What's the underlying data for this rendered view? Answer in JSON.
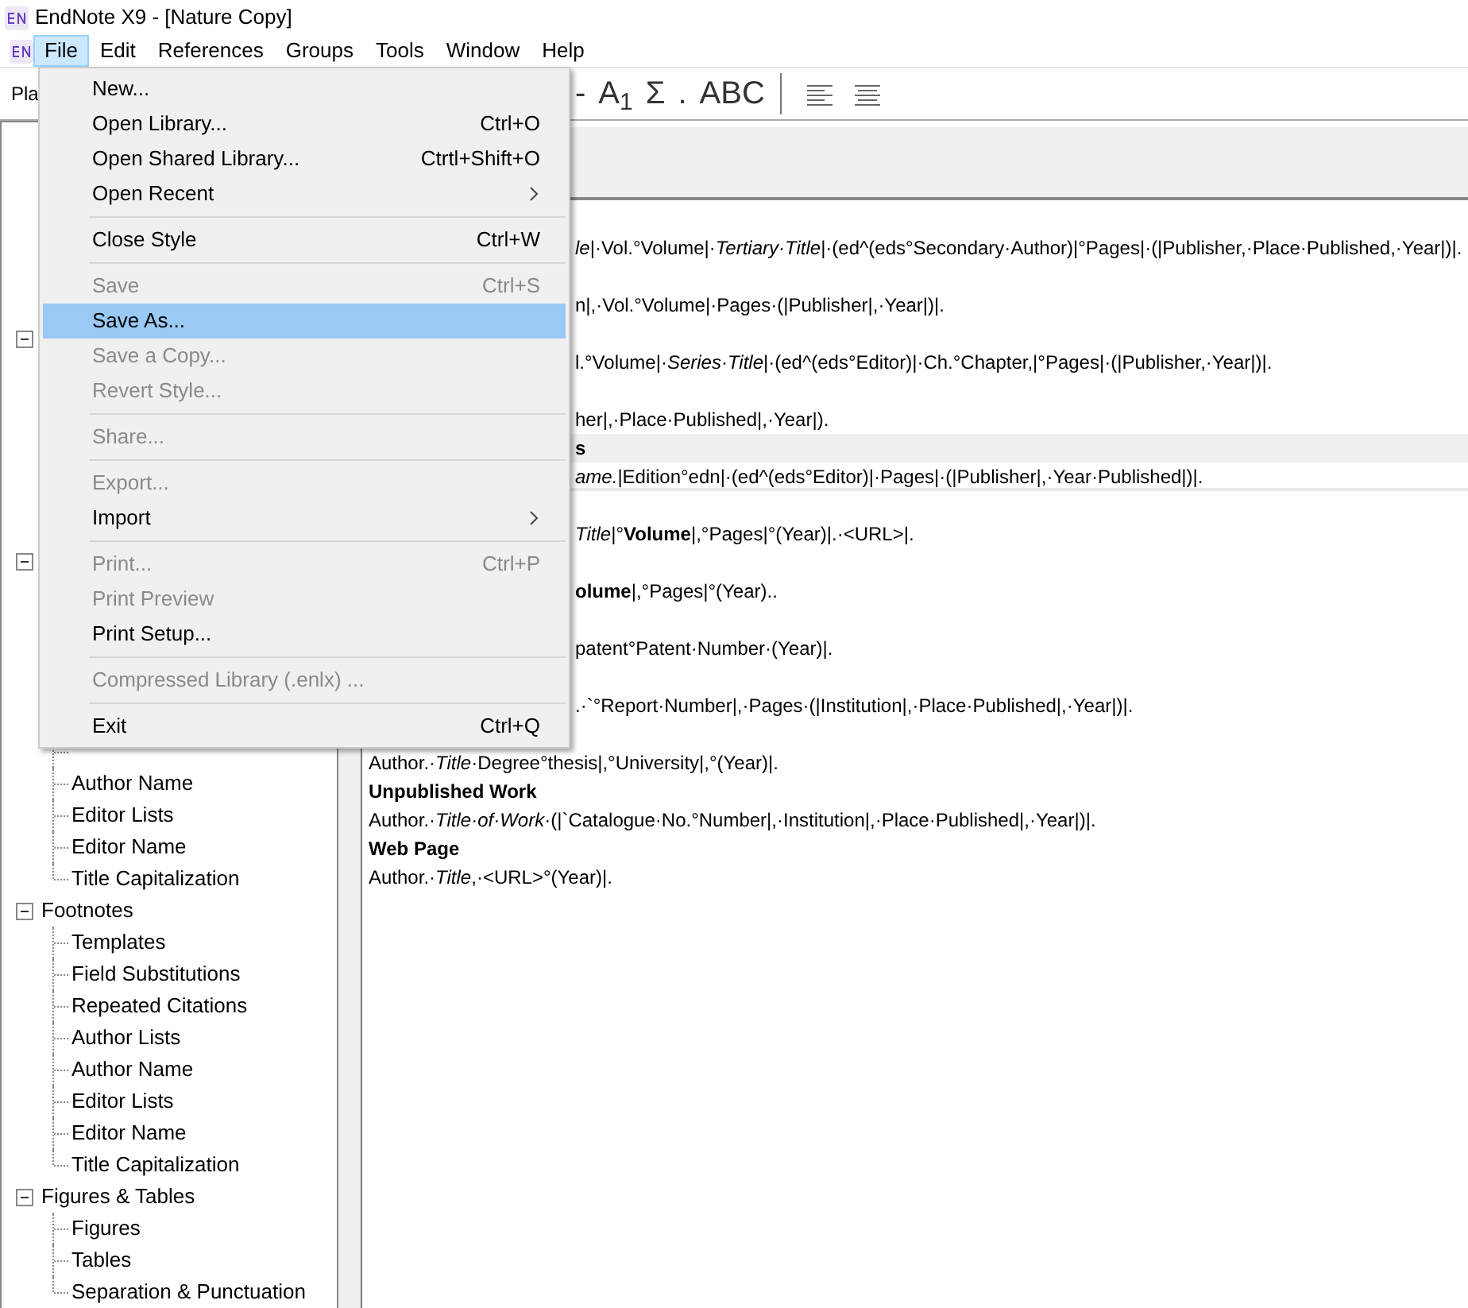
{
  "window": {
    "title": "EndNote X9 - [Nature Copy]"
  },
  "menubar": [
    {
      "label": "File",
      "selected": true
    },
    {
      "label": "Edit",
      "selected": false
    },
    {
      "label": "References",
      "selected": false
    },
    {
      "label": "Groups",
      "selected": false
    },
    {
      "label": "Tools",
      "selected": false
    },
    {
      "label": "Window",
      "selected": false
    },
    {
      "label": "Help",
      "selected": false
    }
  ],
  "toolbar": {
    "field_label": "Pla",
    "buttons": [
      {
        "kind": "text",
        "label": "-"
      },
      {
        "kind": "text",
        "label": "A$_{1}$"
      },
      {
        "kind": "text",
        "label": "Σ"
      },
      {
        "kind": "text",
        "label": "."
      },
      {
        "kind": "text",
        "label": "ABC"
      },
      {
        "kind": "separator"
      },
      {
        "kind": "align-left"
      },
      {
        "kind": "align-center"
      }
    ]
  },
  "tree": [
    {
      "expanded": true
    },
    {
      "expanded": true,
      "children": [
        {
          "label": "Author Name"
        },
        {
          "label": "Editor Lists"
        },
        {
          "label": "Editor Name"
        },
        {
          "label": "Title Capitalization"
        }
      ]
    },
    {
      "label": "Footnotes",
      "expanded": true,
      "children": [
        {
          "label": "Templates"
        },
        {
          "label": "Field Substitutions"
        },
        {
          "label": "Repeated Citations"
        },
        {
          "label": "Author Lists"
        },
        {
          "label": "Author Name"
        },
        {
          "label": "Editor Lists"
        },
        {
          "label": "Editor Name"
        },
        {
          "label": "Title Capitalization"
        }
      ]
    },
    {
      "label": "Figures & Tables",
      "expanded": true,
      "children": [
        {
          "label": "Figures"
        },
        {
          "label": "Tables"
        },
        {
          "label": "Separation & Punctuation"
        }
      ]
    }
  ],
  "templates": [
    {
      "kind": "covered",
      "selected": false,
      "template": "*le*|·Vol.°Volume|·*Tertiary·Title*|·(ed^(eds°Secondary·Author)|°Pages|·(|Publisher,·Place·Published,·Year|)|."
    },
    {
      "kind": "covered",
      "selected": false,
      "template": "n|,·Vol.°Volume|·Pages·(|Publisher|,·Year|)|."
    },
    {
      "kind": "covered",
      "selected": false,
      "template": "l.°Volume|·*Series·Title*|·(ed^(eds°Editor)|·Ch.°Chapter,|°Pages|·(|Publisher,·Year|)|."
    },
    {
      "kind": "covered",
      "selected": false,
      "template": "her|,·Place·Published|,·Year|)."
    },
    {
      "kind": "covered",
      "selected": true,
      "heading": "s",
      "template": "*ame.*|Edition°edn|·(ed^(eds°Editor)|·Pages|·(|Publisher|,·Year·Published|)|."
    },
    {
      "kind": "covered",
      "selected": false,
      "template": "*Title*|°**Volume**|,°Pages|°(Year)|.·<URL>|."
    },
    {
      "kind": "covered",
      "selected": false,
      "template": "**olume**|,°Pages|°(Year).."
    },
    {
      "kind": "covered",
      "selected": false,
      "template": "patent°Patent·Number·(Year)|."
    },
    {
      "kind": "covered",
      "selected": false,
      "template": ".·`°Report·Number|,·Pages·(|Institution|,·Place·Published|,·Year|)|."
    },
    {
      "kind": "full",
      "selected": false,
      "template": "Author.·*Title*·Degree°thesis|,°University|,°(Year)|."
    },
    {
      "kind": "full",
      "selected": false,
      "heading": "Unpublished Work",
      "template": "Author.·*Title·of·Work*·(|`Catalogue·No.°Number|,·Institution|,·Place·Published|,·Year|)|."
    },
    {
      "kind": "full",
      "selected": false,
      "heading": "Web Page",
      "template": "Author.·*Title*,·<URL>°(Year)|."
    }
  ],
  "file_menu": [
    {
      "kind": "item",
      "label": "New...",
      "disabled": false,
      "selected": false
    },
    {
      "kind": "item",
      "label": "Open Library...",
      "shortcut": "Ctrl+O",
      "disabled": false,
      "selected": false
    },
    {
      "kind": "item",
      "label": "Open Shared Library...",
      "shortcut": "Ctrtl+Shift+O",
      "disabled": false,
      "selected": false
    },
    {
      "kind": "submenu",
      "label": "Open Recent",
      "disabled": false,
      "selected": false
    },
    {
      "kind": "separator"
    },
    {
      "kind": "item",
      "label": "Close Style",
      "shortcut": "Ctrl+W",
      "disabled": false,
      "selected": false
    },
    {
      "kind": "separator"
    },
    {
      "kind": "item",
      "label": "Save",
      "shortcut": "Ctrl+S",
      "disabled": true,
      "selected": false
    },
    {
      "kind": "item",
      "label": "Save As...",
      "disabled": false,
      "selected": true
    },
    {
      "kind": "item",
      "label": "Save a Copy...",
      "disabled": true,
      "selected": false
    },
    {
      "kind": "item",
      "label": "Revert Style...",
      "disabled": true,
      "selected": false
    },
    {
      "kind": "separator"
    },
    {
      "kind": "item",
      "label": "Share...",
      "disabled": true,
      "selected": false
    },
    {
      "kind": "separator"
    },
    {
      "kind": "item",
      "label": "Export...",
      "disabled": true,
      "selected": false
    },
    {
      "kind": "submenu",
      "label": "Import",
      "disabled": false,
      "selected": false
    },
    {
      "kind": "separator"
    },
    {
      "kind": "item",
      "label": "Print...",
      "shortcut": "Ctrl+P",
      "disabled": true,
      "selected": false
    },
    {
      "kind": "item",
      "label": "Print Preview",
      "disabled": true,
      "selected": false
    },
    {
      "kind": "item",
      "label": "Print Setup...",
      "disabled": false,
      "selected": false
    },
    {
      "kind": "separator"
    },
    {
      "kind": "item",
      "label": "Compressed Library (.enlx) ...",
      "disabled": true,
      "selected": false
    },
    {
      "kind": "separator"
    },
    {
      "kind": "item",
      "label": "Exit",
      "shortcut": "Ctrl+Q",
      "disabled": false,
      "selected": false
    }
  ]
}
